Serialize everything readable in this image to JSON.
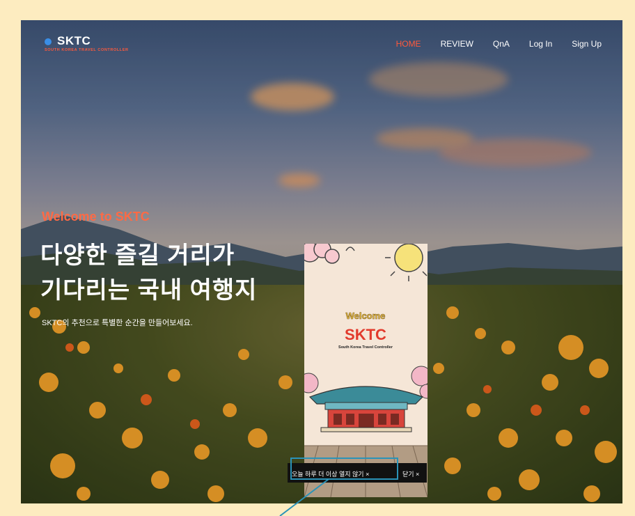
{
  "logo": {
    "title": "SKTC",
    "subtitle": "SOUTH KOREA TRAVEL CONTROLLER"
  },
  "nav": {
    "items": [
      "HOME",
      "REVIEW",
      "QnA",
      "Log In",
      "Sign Up"
    ],
    "active": "HOME"
  },
  "hero": {
    "kicker": "Welcome to SKTC",
    "line1": "다양한 즐길 거리가",
    "line2": "기다리는 국내 여행지",
    "subtitle": "SKTC의 추천으로 특별한 순간을 만들어보세요."
  },
  "popup": {
    "welcome": "Welcome",
    "title": "SKTC",
    "subtitle": "South Korea Travel Controller",
    "dont_show_today": "오늘 하루 더 이상 열지 않기 ×",
    "close": "닫기 ×"
  },
  "colors": {
    "accent": "#ff5a3c",
    "highlight": "#2a93b8"
  }
}
